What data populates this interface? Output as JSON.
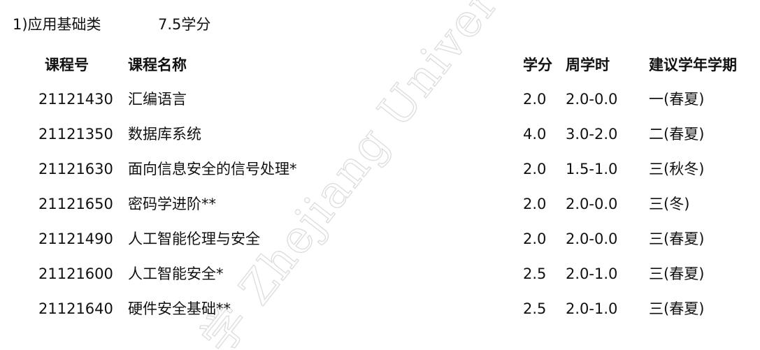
{
  "section": {
    "title": "1)应用基础类",
    "credits": "7.5学分"
  },
  "table": {
    "headers": {
      "code": "课程号",
      "name": "课程名称",
      "credit": "学分",
      "hours": "周学时",
      "term": "建议学年学期"
    },
    "rows": [
      {
        "code": "21121430",
        "name": "汇编语言",
        "credit": "2.0",
        "hours": "2.0-0.0",
        "term": "一(春夏)"
      },
      {
        "code": "21121350",
        "name": "数据库系统",
        "credit": "4.0",
        "hours": "3.0-2.0",
        "term": "二(春夏)"
      },
      {
        "code": "21121630",
        "name": "面向信息安全的信号处理*",
        "credit": "2.0",
        "hours": "1.5-1.0",
        "term": "三(秋冬)"
      },
      {
        "code": "21121650",
        "name": "密码学进阶**",
        "credit": "2.0",
        "hours": "2.0-0.0",
        "term": "三(冬)"
      },
      {
        "code": "21121490",
        "name": "人工智能伦理与安全",
        "credit": "2.0",
        "hours": "2.0-0.0",
        "term": "三(春夏)"
      },
      {
        "code": "21121600",
        "name": "人工智能安全*",
        "credit": "2.5",
        "hours": "2.0-1.0",
        "term": "三(春夏)"
      },
      {
        "code": "21121640",
        "name": "硬件安全基础**",
        "credit": "2.5",
        "hours": "2.0-1.0",
        "term": "三(春夏)"
      }
    ]
  },
  "watermark": {
    "text": "学 Zhejiang University",
    "color": "#dcdcdc"
  }
}
